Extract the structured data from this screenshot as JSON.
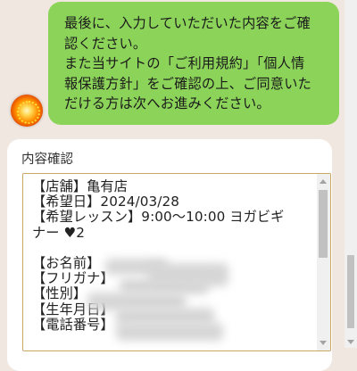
{
  "chat": {
    "bot_message": "最後に、入力していただいた内容をご確\n認ください。\nまた当サイトの「ご利用規約」「個人情\n報保護方針」をご確認の上、ご同意いた\nだける方は次へお進みください。"
  },
  "confirmation": {
    "title": "内容確認",
    "summary": "【店舗】亀有店\n【希望日】2024/03/28\n【希望レッスン】9:00～10:00 ヨガビギ\nナー ♥2\n\n【お名前】\n【フリガナ】\n【性別】\n【生年月日】\n【電話番号】"
  },
  "icons": {
    "bot_avatar": "sun-avatar-icon"
  },
  "colors": {
    "chat_background": "#f1e7e1",
    "bubble_green": "#8cd35a",
    "card_background": "#ffffff",
    "textarea_border": "#c9a765"
  }
}
